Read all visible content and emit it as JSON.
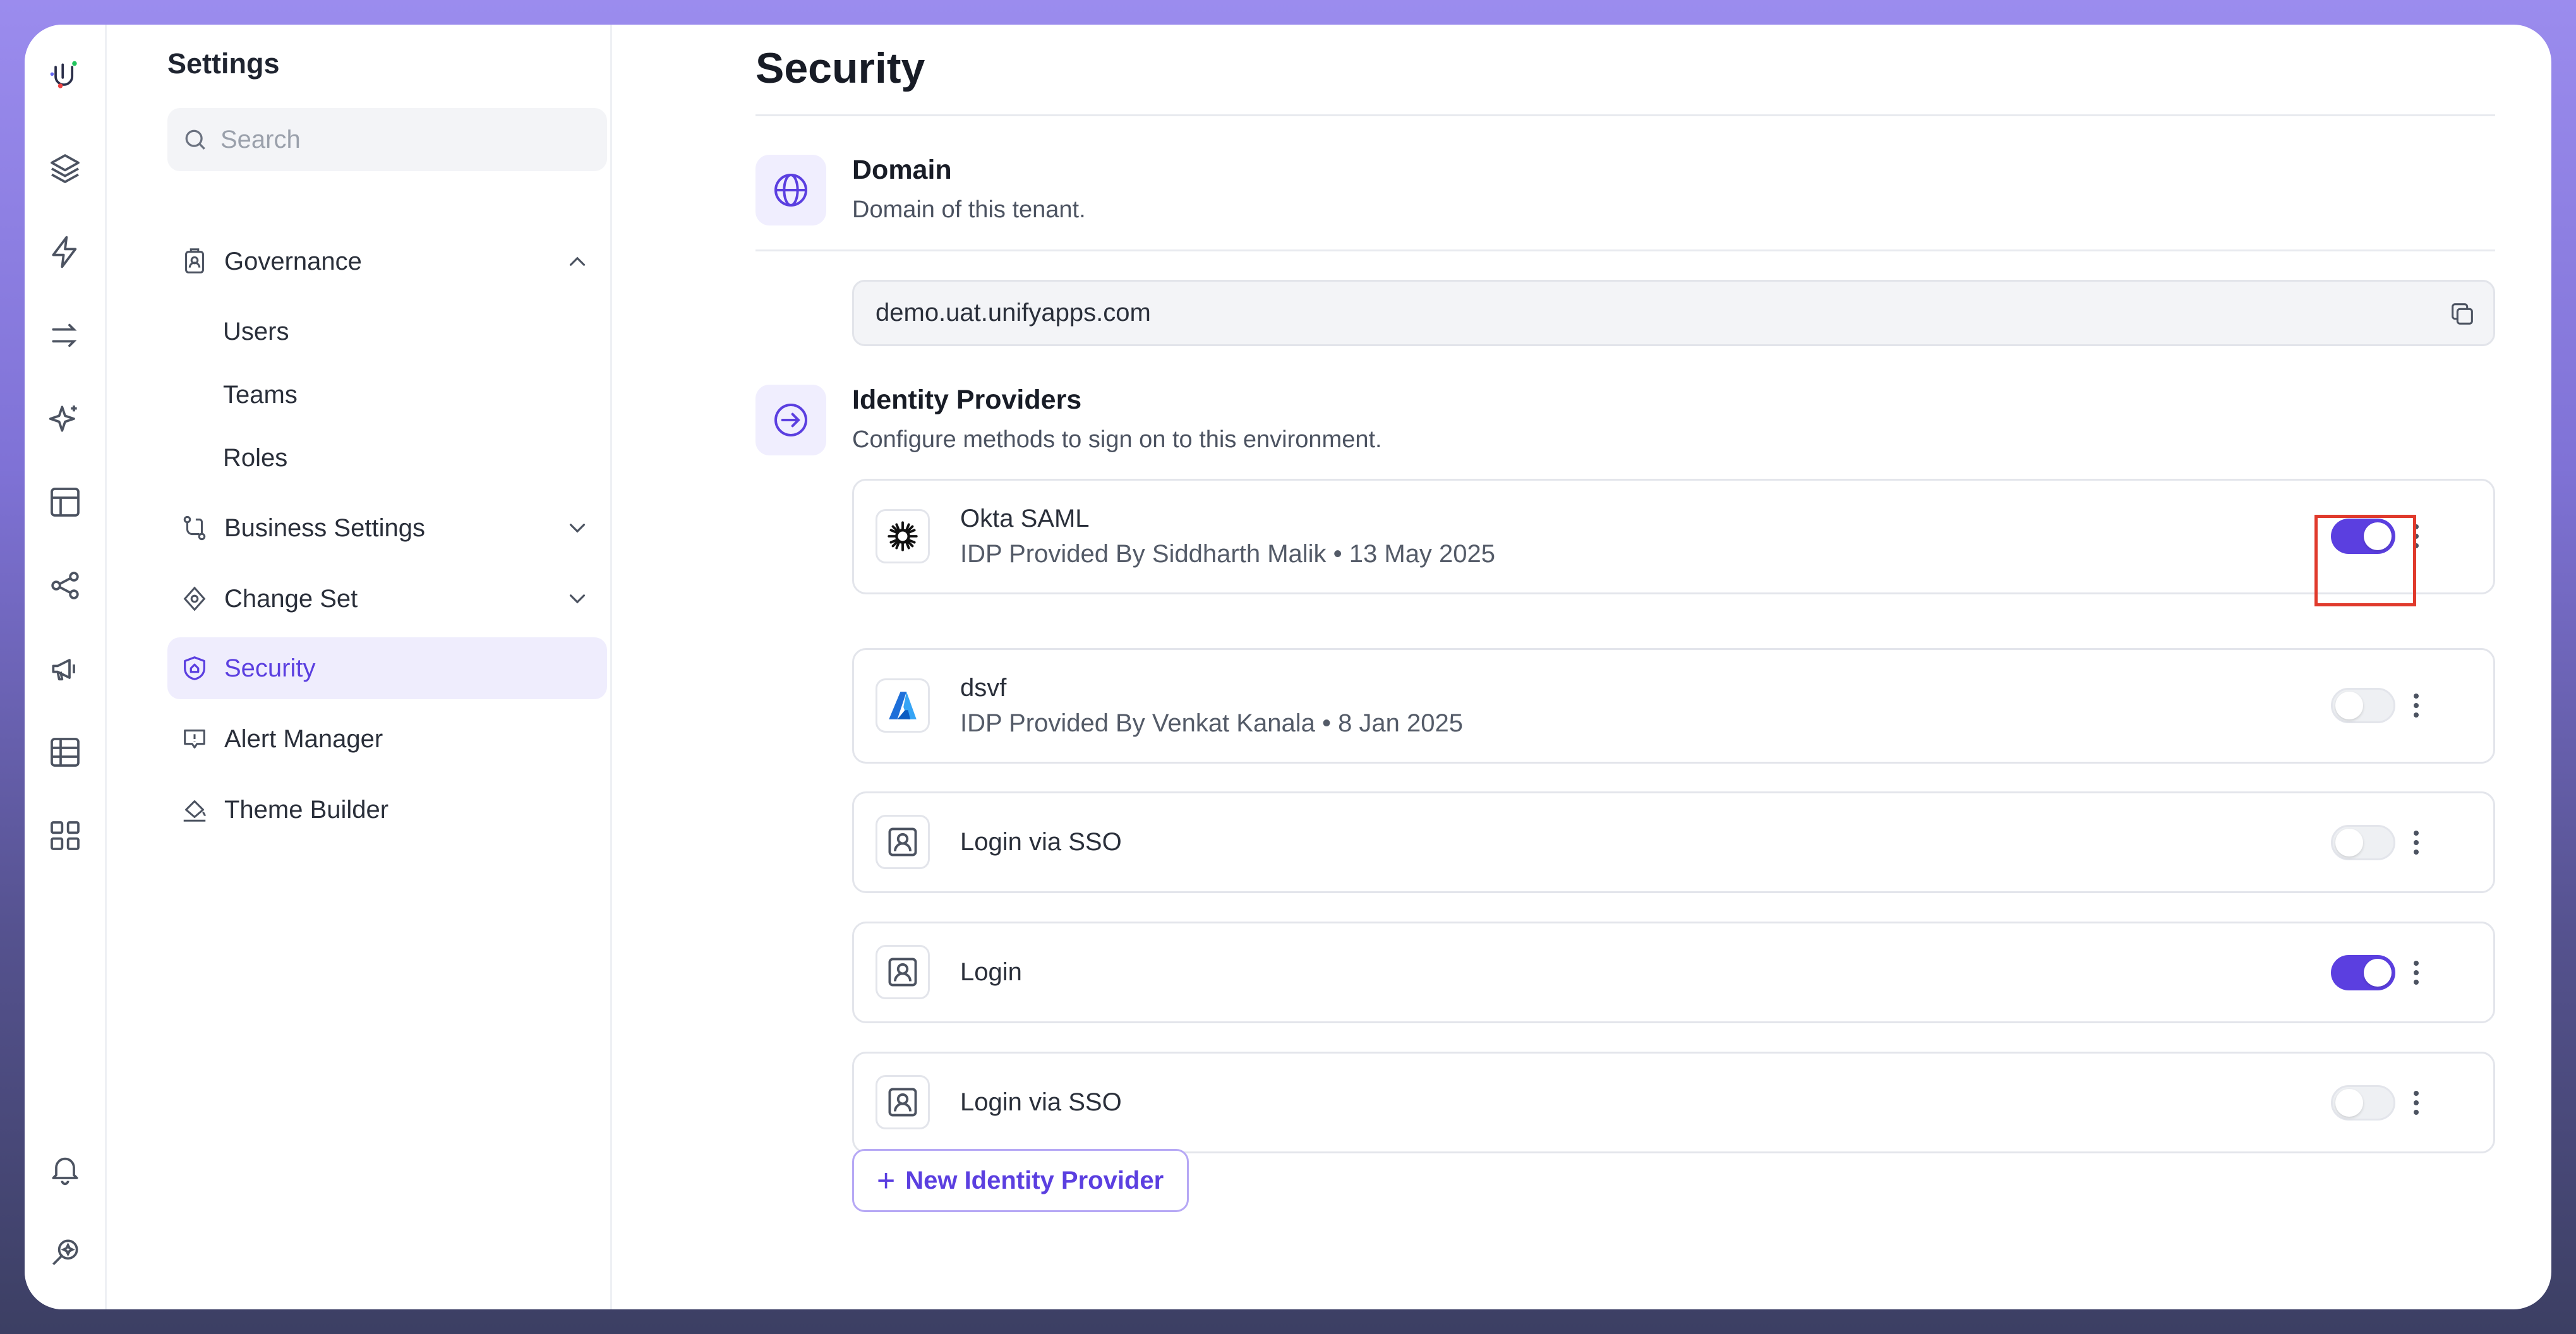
{
  "sidebar": {
    "title": "Settings",
    "search_placeholder": "Search",
    "governance": {
      "label": "Governance",
      "children": [
        "Users",
        "Teams",
        "Roles"
      ]
    },
    "items": [
      {
        "label": "Business Settings"
      },
      {
        "label": "Change Set"
      },
      {
        "label": "Security"
      },
      {
        "label": "Alert Manager"
      },
      {
        "label": "Theme Builder"
      }
    ]
  },
  "main": {
    "title": "Security",
    "domain": {
      "title": "Domain",
      "description": "Domain of this tenant.",
      "value": "demo.uat.unifyapps.com"
    },
    "identity_providers": {
      "title": "Identity Providers",
      "description": "Configure methods to sign on to this environment.",
      "providers": [
        {
          "name": "Okta SAML",
          "meta": "IDP Provided By Siddharth Malik • 13 May 2025",
          "enabled": true,
          "logo": "okta-icon"
        },
        {
          "name": "dsvf",
          "meta": "IDP Provided By Venkat Kanala • 8 Jan 2025",
          "enabled": false,
          "logo": "azure-icon"
        },
        {
          "name": "Login via SSO",
          "meta": "",
          "enabled": false,
          "logo": "user-badge-icon"
        },
        {
          "name": "Login",
          "meta": "",
          "enabled": true,
          "logo": "user-badge-icon"
        },
        {
          "name": "Login via SSO",
          "meta": "",
          "enabled": false,
          "logo": "user-badge-icon"
        }
      ],
      "new_button_label": "New Identity Provider"
    }
  },
  "colors": {
    "accent": "#5b3fe0",
    "highlight": "#e03a2c"
  }
}
